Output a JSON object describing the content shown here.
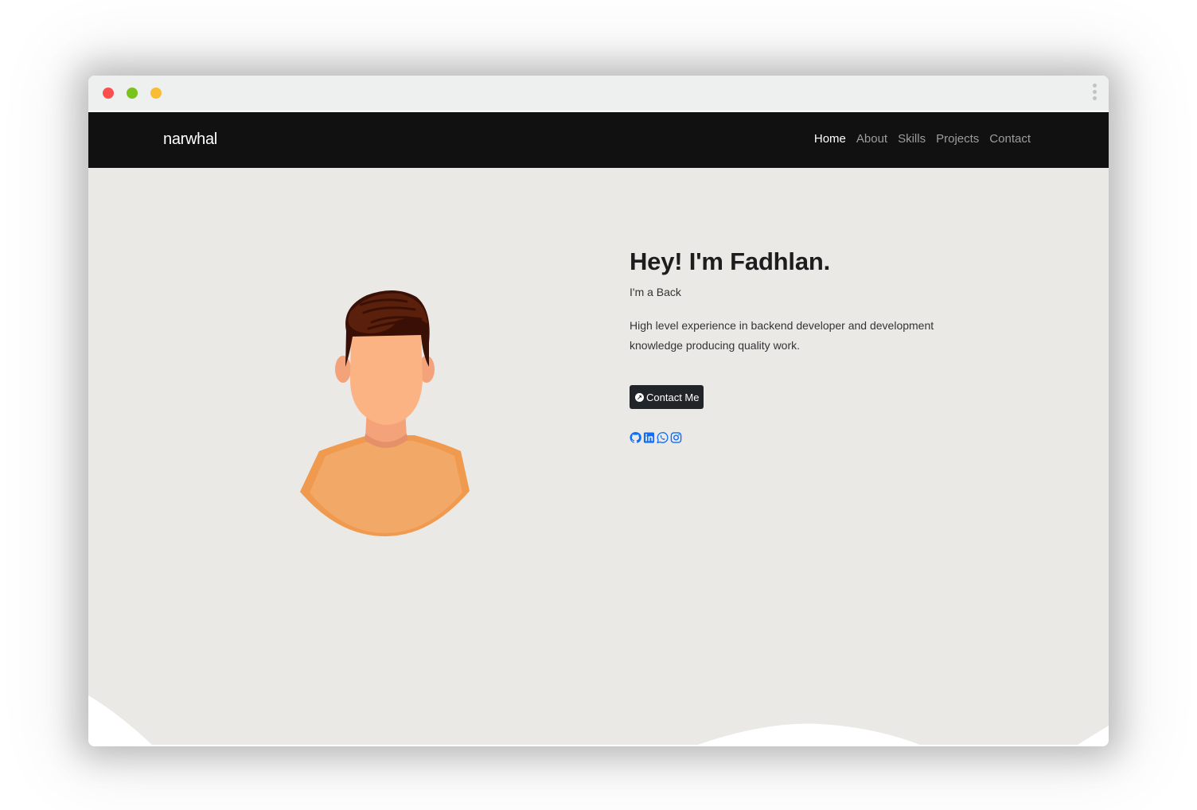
{
  "window": {
    "traffic_lights": [
      {
        "name": "close",
        "color": "#fb4f4f"
      },
      {
        "name": "maximize",
        "color": "#7ac21c"
      },
      {
        "name": "minimize",
        "color": "#f8bd34"
      }
    ]
  },
  "navbar": {
    "brand": "narwhal",
    "links": [
      {
        "label": "Home",
        "active": true
      },
      {
        "label": "About",
        "active": false
      },
      {
        "label": "Skills",
        "active": false
      },
      {
        "label": "Projects",
        "active": false
      },
      {
        "label": "Contact",
        "active": false
      }
    ]
  },
  "hero": {
    "title": "Hey! I'm Fadhlan.",
    "subtitle": "I'm a Back",
    "description_line1": "High level experience in backend developer and development",
    "description_line2": "knowledge producing quality work.",
    "cta_label": "Contact Me",
    "socials": [
      {
        "icon": "github-icon"
      },
      {
        "icon": "linkedin-icon"
      },
      {
        "icon": "whatsapp-icon"
      },
      {
        "icon": "instagram-icon"
      }
    ]
  },
  "colors": {
    "navbar_bg": "#111111",
    "hero_bg": "#eae9e6",
    "button_bg": "#212529",
    "social_icon": "#0d6efd"
  }
}
